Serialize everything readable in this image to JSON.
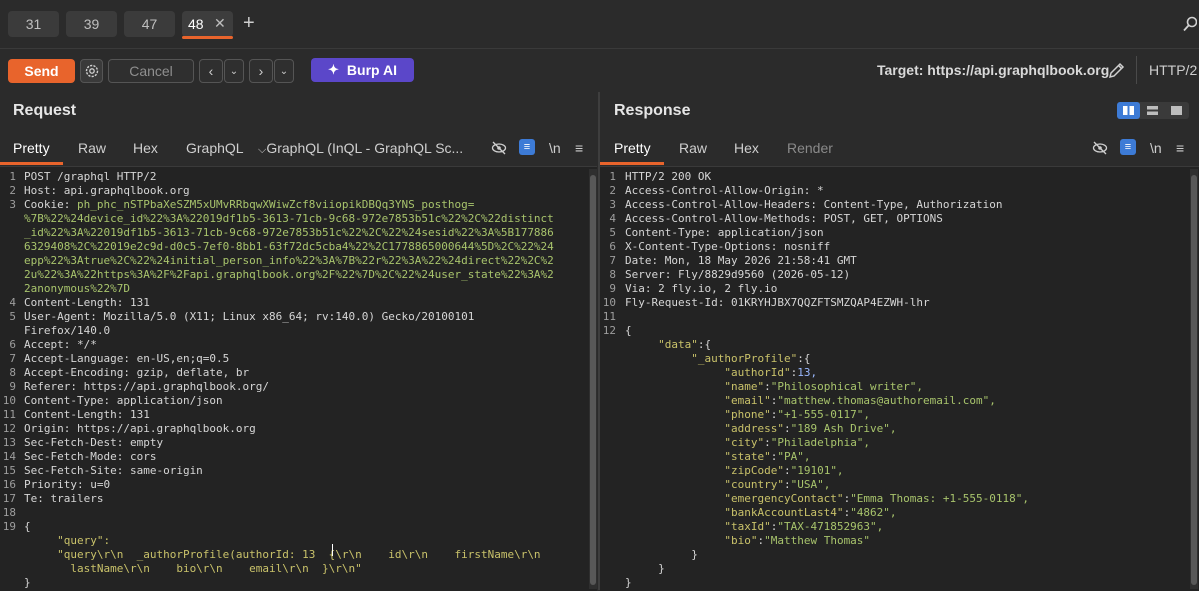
{
  "tabs": [
    {
      "label": "31"
    },
    {
      "label": "39"
    },
    {
      "label": "47"
    },
    {
      "label": "48"
    }
  ],
  "toolbar": {
    "send_label": "Send",
    "cancel_label": "Cancel",
    "burp_ai_label": "Burp AI",
    "target_text": "Target: https://api.graphqlbook.org",
    "protocol": "HTTP/2"
  },
  "request": {
    "title": "Request",
    "tabs": [
      "Pretty",
      "Raw",
      "Hex",
      "GraphQL",
      "GraphQL (InQL - GraphQL Sc..."
    ],
    "wrap_label": "\\n",
    "lines": [
      {
        "n": "1",
        "t": "POST /graphql HTTP/2"
      },
      {
        "n": "2",
        "t": "Host: api.graphqlbook.org"
      },
      {
        "n": "3",
        "t": "Cookie: ph_phc_nSTPbaXeSZM5xUMvRRbqwXWiwZcf8viiopikDBQq3YNS_posthog="
      },
      {
        "n": "",
        "t": "%7B%22%24device_id%22%3A%22019df1b5-3613-71cb-9c68-972e7853b51c%22%2C%22distinct"
      },
      {
        "n": "",
        "t": "_id%22%3A%22019df1b5-3613-71cb-9c68-972e7853b51c%22%2C%22%24sesid%22%3A%5B177886"
      },
      {
        "n": "",
        "t": "6329408%2C%22019e2c9d-d0c5-7ef0-8bb1-63f72dc5cba4%22%2C1778865000644%5D%2C%22%24"
      },
      {
        "n": "",
        "t": "epp%22%3Atrue%2C%22%24initial_person_info%22%3A%7B%22r%22%3A%22%24direct%22%2C%2"
      },
      {
        "n": "",
        "t": "2u%22%3A%22https%3A%2F%2Fapi.graphqlbook.org%2F%22%7D%2C%22%24user_state%22%3A%2"
      },
      {
        "n": "",
        "t": "2anonymous%22%7D"
      },
      {
        "n": "4",
        "t": "Content-Length: 131"
      },
      {
        "n": "5",
        "t": "User-Agent: Mozilla/5.0 (X11; Linux x86_64; rv:140.0) Gecko/20100101"
      },
      {
        "n": "",
        "t": "Firefox/140.0"
      },
      {
        "n": "6",
        "t": "Accept: */*"
      },
      {
        "n": "7",
        "t": "Accept-Language: en-US,en;q=0.5"
      },
      {
        "n": "8",
        "t": "Accept-Encoding: gzip, deflate, br"
      },
      {
        "n": "9",
        "t": "Referer: https://api.graphqlbook.org/"
      },
      {
        "n": "10",
        "t": "Content-Type: application/json"
      },
      {
        "n": "11",
        "t": "Content-Length: 131"
      },
      {
        "n": "12",
        "t": "Origin: https://api.graphqlbook.org"
      },
      {
        "n": "13",
        "t": "Sec-Fetch-Dest: empty"
      },
      {
        "n": "14",
        "t": "Sec-Fetch-Mode: cors"
      },
      {
        "n": "15",
        "t": "Sec-Fetch-Site: same-origin"
      },
      {
        "n": "16",
        "t": "Priority: u=0"
      },
      {
        "n": "17",
        "t": "Te: trailers"
      },
      {
        "n": "18",
        "t": ""
      },
      {
        "n": "19",
        "t": "{"
      },
      {
        "n": "",
        "t": "     \"query\":"
      },
      {
        "n": "",
        "t": "     \"query\\r\\n  _authorProfile(authorId: 13  {\\r\\n    id\\r\\n    firstName\\r\\n"
      },
      {
        "n": "",
        "t": "       lastName\\r\\n    bio\\r\\n    email\\r\\n  }\\r\\n\""
      },
      {
        "n": "",
        "t": "}"
      }
    ]
  },
  "response": {
    "title": "Response",
    "tabs": [
      "Pretty",
      "Raw",
      "Hex",
      "Render"
    ],
    "wrap_label": "\\n",
    "lines": [
      {
        "n": "1",
        "t": "HTTP/2 200 OK"
      },
      {
        "n": "2",
        "t": "Access-Control-Allow-Origin: *"
      },
      {
        "n": "3",
        "t": "Access-Control-Allow-Headers: Content-Type, Authorization"
      },
      {
        "n": "4",
        "t": "Access-Control-Allow-Methods: POST, GET, OPTIONS"
      },
      {
        "n": "5",
        "t": "Content-Type: application/json"
      },
      {
        "n": "6",
        "t": "X-Content-Type-Options: nosniff"
      },
      {
        "n": "7",
        "t": "Date: Mon, 18 May 2026 21:58:41 GMT"
      },
      {
        "n": "8",
        "t": "Server: Fly/8829d9560 (2026-05-12)"
      },
      {
        "n": "9",
        "t": "Via: 2 fly.io, 2 fly.io"
      },
      {
        "n": "10",
        "t": "Fly-Request-Id: 01KRYHJBX7QQZFTSMZQAP4EZWH-lhr"
      },
      {
        "n": "11",
        "t": ""
      },
      {
        "n": "12",
        "t": "{"
      },
      {
        "n": "",
        "t": "     \"data\":{"
      },
      {
        "n": "",
        "t": "          \"_authorProfile\":{"
      },
      {
        "n": "",
        "t": "               \"authorId\":13,"
      },
      {
        "n": "",
        "t": "               \"name\":\"Philosophical writer\","
      },
      {
        "n": "",
        "t": "               \"email\":\"matthew.thomas@authoremail.com\","
      },
      {
        "n": "",
        "t": "               \"phone\":\"+1-555-0117\","
      },
      {
        "n": "",
        "t": "               \"address\":\"189 Ash Drive\","
      },
      {
        "n": "",
        "t": "               \"city\":\"Philadelphia\","
      },
      {
        "n": "",
        "t": "               \"state\":\"PA\","
      },
      {
        "n": "",
        "t": "               \"zipCode\":\"19101\","
      },
      {
        "n": "",
        "t": "               \"country\":\"USA\","
      },
      {
        "n": "",
        "t": "               \"emergencyContact\":\"Emma Thomas: +1-555-0118\","
      },
      {
        "n": "",
        "t": "               \"bankAccountLast4\":\"4862\","
      },
      {
        "n": "",
        "t": "               \"taxId\":\"TAX-471852963\","
      },
      {
        "n": "",
        "t": "               \"bio\":\"Matthew Thomas\""
      },
      {
        "n": "",
        "t": "          }"
      },
      {
        "n": "",
        "t": "     }"
      },
      {
        "n": "",
        "t": "}"
      }
    ]
  },
  "colors": {
    "accent": "#e8642c",
    "burp_ai": "#5b47c9",
    "toggle_on": "#3d7bd6"
  }
}
